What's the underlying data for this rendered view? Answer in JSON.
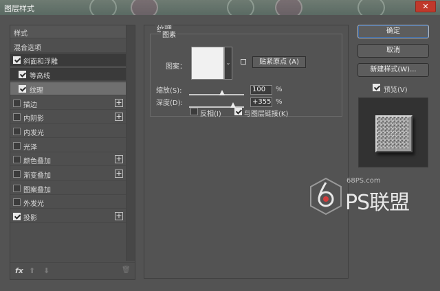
{
  "window": {
    "title": "图层样式",
    "close_glyph": "✕"
  },
  "left_panel": {
    "items": [
      {
        "label": "样式",
        "checkbox": false,
        "checked": false,
        "plus": false
      },
      {
        "label": "混合选项",
        "checkbox": false,
        "checked": false,
        "plus": false
      },
      {
        "label": "斜面和浮雕",
        "checkbox": true,
        "checked": true,
        "plus": false
      },
      {
        "label": "等高线",
        "checkbox": true,
        "checked": true,
        "plus": false,
        "indent": true
      },
      {
        "label": "纹理",
        "checkbox": true,
        "checked": true,
        "plus": false,
        "indent": true,
        "selected": true
      },
      {
        "label": "描边",
        "checkbox": true,
        "checked": false,
        "plus": true
      },
      {
        "label": "内阴影",
        "checkbox": true,
        "checked": false,
        "plus": true
      },
      {
        "label": "内发光",
        "checkbox": true,
        "checked": false,
        "plus": false
      },
      {
        "label": "光泽",
        "checkbox": true,
        "checked": false,
        "plus": false
      },
      {
        "label": "颜色叠加",
        "checkbox": true,
        "checked": false,
        "plus": true
      },
      {
        "label": "渐变叠加",
        "checkbox": true,
        "checked": false,
        "plus": true
      },
      {
        "label": "图案叠加",
        "checkbox": true,
        "checked": false,
        "plus": false
      },
      {
        "label": "外发光",
        "checkbox": true,
        "checked": false,
        "plus": false
      },
      {
        "label": "投影",
        "checkbox": true,
        "checked": true,
        "plus": true
      }
    ],
    "plus_glyph": "+",
    "footer": {
      "fx_label": "fx",
      "up_glyph": "⬆",
      "down_glyph": "⬇",
      "trash_glyph": "🗑"
    }
  },
  "texture": {
    "group_title": "纹理",
    "subgroup_title": "图素",
    "pattern_label": "图案：",
    "pattern_drop_glyph": "⌄",
    "snap_button": "贴紧原点 (A)",
    "scale_label": "缩放(S):",
    "scale_value": "100",
    "scale_percent": 1.0,
    "depth_label": "深度(D):",
    "depth_value": "+355",
    "depth_percent": 1.0,
    "percent_unit": "%",
    "invert_label": "反相(I)",
    "invert_checked": false,
    "link_label": "与图层链接(K)",
    "link_checked": true
  },
  "right_panel": {
    "ok_label": "确定",
    "cancel_label": "取消",
    "new_style_label": "新建样式(W)...",
    "preview_label": "预览(V)",
    "preview_checked": true
  },
  "watermark": {
    "url": "68PS.com",
    "text": "PS联盟"
  }
}
